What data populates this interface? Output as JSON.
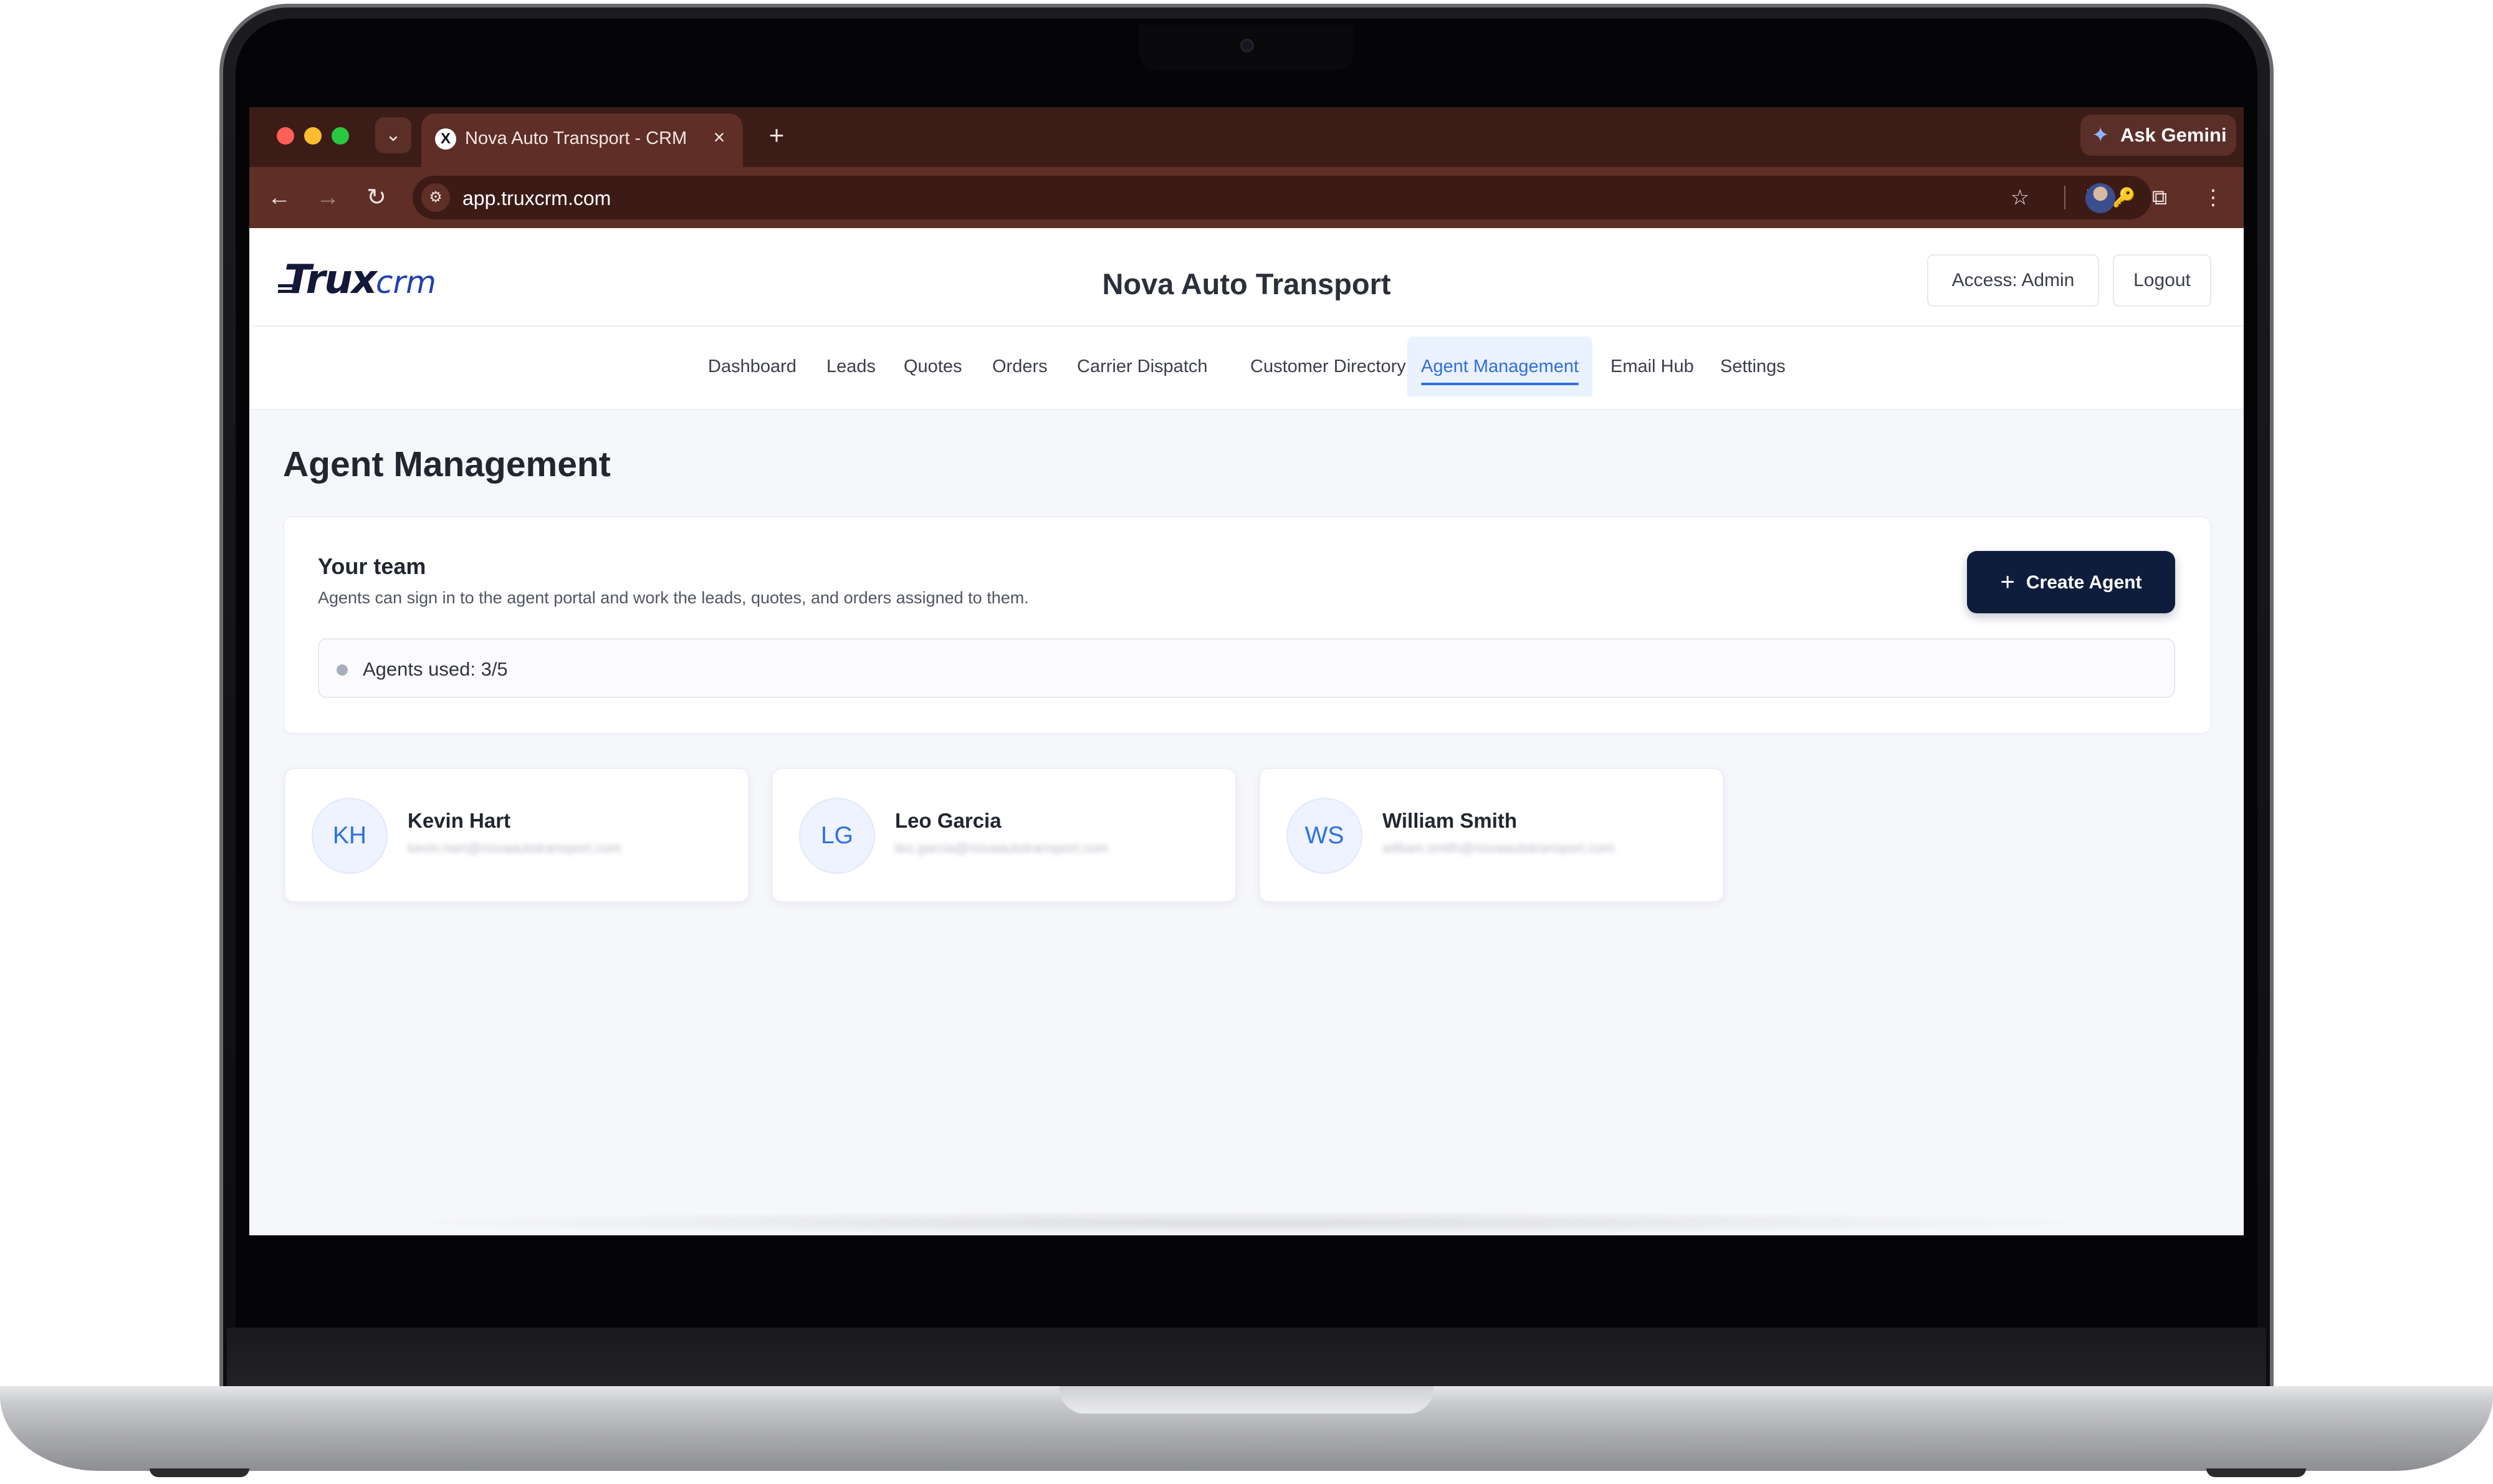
{
  "browser": {
    "tab_title": "Nova Auto Transport - CRM",
    "tab_favicon": "X",
    "tab_close": "×",
    "new_tab": "+",
    "tab_dropdown": "⌄",
    "gemini_label": "Ask Gemini",
    "url": "app.truxcrm.com",
    "icons": {
      "back": "←",
      "forward": "→",
      "reload": "↻",
      "site_info": "⚙",
      "install": "⎘",
      "password": "🔑",
      "bookmark": "☆",
      "extensions": "⧉",
      "menu": "⋮",
      "gemini": "✦"
    }
  },
  "header": {
    "logo_trux": "Trux",
    "logo_crm": "crm",
    "company": "Nova Auto Transport",
    "access_label": "Access: Admin",
    "logout_label": "Logout"
  },
  "nav": {
    "items": [
      {
        "label": "Dashboard"
      },
      {
        "label": "Leads"
      },
      {
        "label": "Quotes"
      },
      {
        "label": "Orders"
      },
      {
        "label": "Carrier Dispatch"
      },
      {
        "label": "Customer Directory"
      },
      {
        "label": "Agent Management",
        "active": true
      },
      {
        "label": "Email Hub"
      },
      {
        "label": "Settings"
      }
    ]
  },
  "page": {
    "title": "Agent Management",
    "team": {
      "title": "Your team",
      "description": "Agents can sign in to the agent portal and work the leads, quotes, and orders assigned to them.",
      "create_label": "Create Agent",
      "create_icon": "+",
      "usage": "Agents used: 3/5"
    },
    "agents": [
      {
        "initials": "KH",
        "name": "Kevin Hart",
        "email": "kevin.hart@novaautotransport.com"
      },
      {
        "initials": "LG",
        "name": "Leo Garcia",
        "email": "leo.garcia@novaautotransport.com"
      },
      {
        "initials": "WS",
        "name": "William Smith",
        "email": "william.smith@novaautotransport.com"
      }
    ]
  },
  "colors": {
    "accent": "#2f6fe0",
    "primary_button": "#0f1d3d",
    "browser_frame": "#5e2e27"
  }
}
